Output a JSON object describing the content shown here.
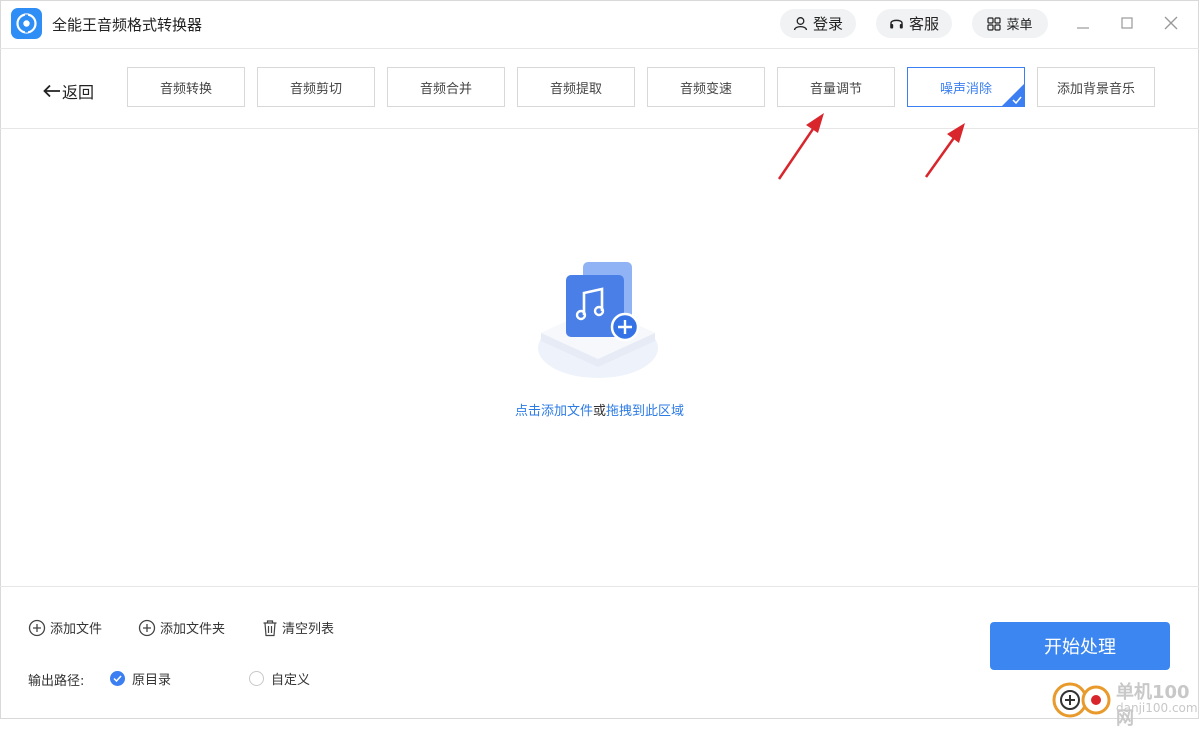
{
  "app": {
    "title": "全能王音频格式转换器"
  },
  "header": {
    "login_label": "登录",
    "service_label": "客服",
    "menu_label": "菜单"
  },
  "nav": {
    "back_label": "返回",
    "tabs": [
      {
        "label": "音频转换",
        "active": false
      },
      {
        "label": "音频剪切",
        "active": false
      },
      {
        "label": "音频合并",
        "active": false
      },
      {
        "label": "音频提取",
        "active": false
      },
      {
        "label": "音频变速",
        "active": false
      },
      {
        "label": "音量调节",
        "active": false
      },
      {
        "label": "噪声消除",
        "active": true
      },
      {
        "label": "添加背景音乐",
        "active": false
      }
    ]
  },
  "drop_area": {
    "click_text": "点击添加文件",
    "or_text": "或",
    "drag_text": "拖拽到此区域"
  },
  "actions": {
    "add_file": "添加文件",
    "add_folder": "添加文件夹",
    "clear_list": "清空列表"
  },
  "output": {
    "label": "输出路径:",
    "options": [
      {
        "label": "原目录",
        "selected": true
      },
      {
        "label": "自定义",
        "selected": false
      }
    ]
  },
  "start_button": "开始处理",
  "watermark": {
    "title": "单机100网",
    "url": "danji100.com"
  },
  "colors": {
    "accent": "#3b7ff2",
    "link": "#2c7be5",
    "annotation_arrow": "#d8262c"
  }
}
